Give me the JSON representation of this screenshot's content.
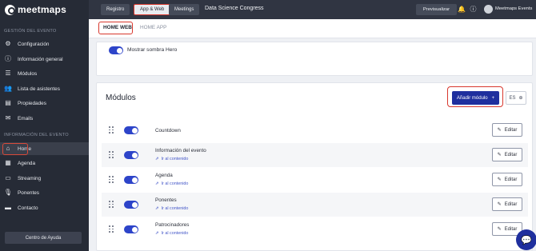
{
  "brand": {
    "name": "meetmaps"
  },
  "sidebar": {
    "section_event": "GESTIÓN DEL EVENTO",
    "section_info": "INFORMACIÓN DEL EVENTO",
    "event_items": [
      {
        "label": "Configuración",
        "icon": "gear-icon"
      },
      {
        "label": "Información general",
        "icon": "info-icon"
      },
      {
        "label": "Módulos",
        "icon": "list-icon"
      },
      {
        "label": "Lista de asistentes",
        "icon": "users-icon"
      },
      {
        "label": "Propiedades",
        "icon": "properties-icon"
      },
      {
        "label": "Emails",
        "icon": "mail-icon"
      }
    ],
    "info_items": [
      {
        "label": "Home",
        "icon": "home-icon",
        "active": true
      },
      {
        "label": "Agenda",
        "icon": "calendar-icon"
      },
      {
        "label": "Streaming",
        "icon": "streaming-icon"
      },
      {
        "label": "Ponentes",
        "icon": "microphone-icon"
      },
      {
        "label": "Contacto",
        "icon": "chat-icon"
      }
    ],
    "help_label": "Centro de Ayuda"
  },
  "topbar": {
    "tabs": [
      {
        "label": "Registro",
        "active": false
      },
      {
        "label": "App & Web",
        "active": true
      },
      {
        "label": "Meetings",
        "active": false
      }
    ],
    "event_title": "Data Science Congress",
    "preview_label": "Previsualizar",
    "user_name": "Meetmaps Events"
  },
  "subtabs": [
    {
      "label": "HOME WEB",
      "active": true
    },
    {
      "label": "HOME APP",
      "active": false
    }
  ],
  "hero": {
    "label": "Mostrar sombra Hero",
    "enabled": true
  },
  "modules": {
    "title": "Módulos",
    "add_label": "Añadir módulo",
    "add_icon": "plus-icon",
    "lang": "ES",
    "edit_label": "Editar",
    "link_label": "Ir al contenido",
    "items": [
      {
        "name": "Countdown",
        "has_link": false,
        "enabled": true
      },
      {
        "name": "Información del evento",
        "has_link": true,
        "enabled": true
      },
      {
        "name": "Agenda",
        "has_link": true,
        "enabled": true
      },
      {
        "name": "Ponentes",
        "has_link": true,
        "enabled": true
      },
      {
        "name": "Patrocinadores",
        "has_link": true,
        "enabled": true
      }
    ]
  },
  "colors": {
    "primary": "#1f2f9e",
    "toggle": "#2d44c9",
    "sidebar": "#262b36",
    "highlight": "#d8372d"
  }
}
